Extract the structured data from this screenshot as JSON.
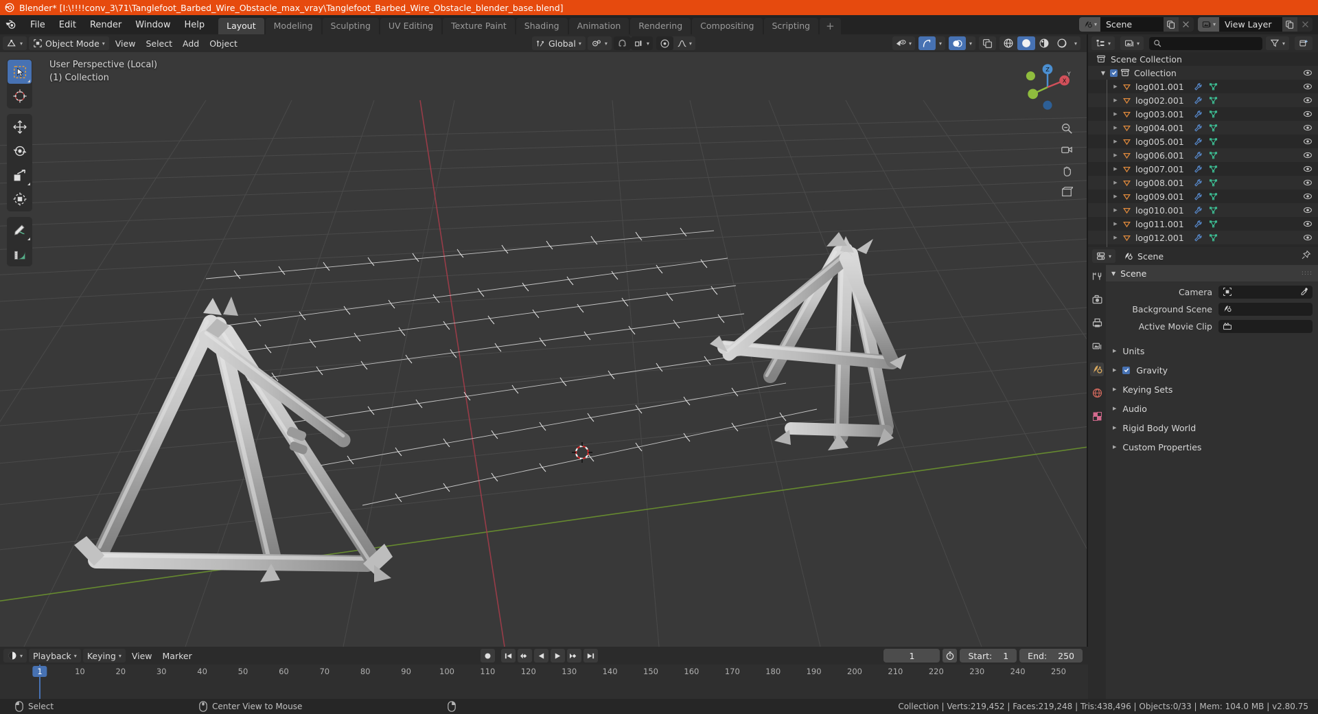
{
  "window": {
    "title": "Blender* [I:\\!!!!conv_3\\71\\Tanglefoot_Barbed_Wire_Obstacle_max_vray\\Tanglefoot_Barbed_Wire_Obstacle_blender_base.blend]",
    "app_icon": "blender-logo-icon"
  },
  "topbar": {
    "menus": [
      "File",
      "Edit",
      "Render",
      "Window",
      "Help"
    ],
    "workspace_tabs": [
      {
        "label": "Layout",
        "active": true
      },
      {
        "label": "Modeling",
        "active": false
      },
      {
        "label": "Sculpting",
        "active": false
      },
      {
        "label": "UV Editing",
        "active": false
      },
      {
        "label": "Texture Paint",
        "active": false
      },
      {
        "label": "Shading",
        "active": false
      },
      {
        "label": "Animation",
        "active": false
      },
      {
        "label": "Rendering",
        "active": false
      },
      {
        "label": "Compositing",
        "active": false
      },
      {
        "label": "Scripting",
        "active": false
      }
    ],
    "add_workspace_label": "+",
    "scene": {
      "name": "Scene",
      "icon": "scene-icon",
      "new_icon": "duplicate-icon",
      "unlink_icon": "close-icon"
    },
    "view_layer": {
      "name": "View Layer",
      "icon": "view-layer-icon",
      "new_icon": "duplicate-icon",
      "unlink_icon": "close-icon"
    }
  },
  "viewport_header": {
    "editor_type_icon": "editor-type-3dview-icon",
    "mode": "Object Mode",
    "mode_icon": "object-mode-icon",
    "menus": [
      "View",
      "Select",
      "Add",
      "Object"
    ],
    "transform_orientation": "Global",
    "transform_orientation_icon": "orientation-icon",
    "pivot_icon": "pivot-point-icon",
    "snap_icon": "magnet-icon",
    "snap_target_icon": "snap-increment-icon",
    "proportional_icon": "proportional-edit-icon",
    "falloff_icon": "smooth-falloff-icon",
    "visibility_icon": "visibility-icon",
    "gizmo_icon": "gizmo-icon",
    "overlays_icon": "overlays-icon",
    "xray_icon": "xray-icon",
    "shading_modes": [
      {
        "name": "wireframe-shading",
        "active": false
      },
      {
        "name": "solid-shading",
        "active": true
      },
      {
        "name": "material-preview-shading",
        "active": false
      },
      {
        "name": "rendered-shading",
        "active": false
      }
    ]
  },
  "viewport": {
    "overlay_line1": "User Perspective (Local)",
    "overlay_line2": "(1) Collection",
    "background_color": "#393939",
    "grid_color": "#4b4b4b",
    "x_axis_color": "#a33d4a",
    "y_axis_color": "#6b932f",
    "tools": [
      {
        "name": "tweak-select-box-tool",
        "label": "Select Box",
        "active": true
      },
      {
        "name": "cursor-tool",
        "label": "Cursor",
        "active": false
      },
      {
        "name": "move-tool",
        "label": "Move",
        "active": false
      },
      {
        "name": "rotate-tool",
        "label": "Rotate",
        "active": false
      },
      {
        "name": "scale-tool",
        "label": "Scale",
        "active": false
      },
      {
        "name": "transform-tool",
        "label": "Transform",
        "active": false
      },
      {
        "name": "annotate-tool",
        "label": "Annotate",
        "active": false
      },
      {
        "name": "measure-tool",
        "label": "Measure",
        "active": false
      }
    ],
    "gizmo_axes": [
      {
        "label": "X",
        "color": "#d1505a"
      },
      {
        "label": "Y",
        "color": "#8fbc3e"
      },
      {
        "label": "Z",
        "color": "#4b8fd1"
      }
    ],
    "nav_buttons": [
      "zoom-icon",
      "camera-icon",
      "hand-icon",
      "perspective-icon"
    ]
  },
  "outliner": {
    "display_mode_icon": "outliner-display-mode-icon",
    "filter_id_icon": "filter-id-icon",
    "search_placeholder": "",
    "search_value": "",
    "filter_icon": "funnel-icon",
    "new_collection_icon": "new-collection-icon",
    "scene_collection": {
      "label": "Scene Collection",
      "icon": "collection-icon"
    },
    "collection": {
      "label": "Collection",
      "icon": "collection-icon",
      "checked": true,
      "expanded": true
    },
    "objects": [
      {
        "name": "log001.001"
      },
      {
        "name": "log002.001"
      },
      {
        "name": "log003.001"
      },
      {
        "name": "log004.001"
      },
      {
        "name": "log005.001"
      },
      {
        "name": "log006.001"
      },
      {
        "name": "log007.001"
      },
      {
        "name": "log008.001"
      },
      {
        "name": "log009.001"
      },
      {
        "name": "log010.001"
      },
      {
        "name": "log011.001"
      },
      {
        "name": "log012.001"
      }
    ],
    "object_icon": "mesh-object-icon",
    "modifier_icon": "wrench-modifier-icon",
    "mesh_data_icon": "mesh-data-icon",
    "visibility_icon": "eye-icon",
    "colors": {
      "object": "#e08a3c",
      "modifier": "#5a8fd6",
      "mesh_data": "#3ec79a"
    }
  },
  "properties": {
    "editor_icon": "properties-editor-icon",
    "breadcrumb": "Scene",
    "breadcrumb_icon": "scene-icon",
    "pin_icon": "pin-icon",
    "tabs": [
      {
        "name": "tool-tab",
        "icon": "tool-icon",
        "active": false
      },
      {
        "name": "render-tab",
        "icon": "camera-back-icon",
        "active": false
      },
      {
        "name": "output-tab",
        "icon": "printer-icon",
        "active": false
      },
      {
        "name": "view-layer-tab",
        "icon": "images-icon",
        "active": false
      },
      {
        "name": "scene-tab",
        "icon": "scene-icon",
        "active": true
      },
      {
        "name": "world-tab",
        "icon": "world-icon",
        "active": false
      },
      {
        "name": "texture-tab",
        "icon": "checker-icon",
        "active": false
      }
    ],
    "panel_title": "Scene",
    "fields": [
      {
        "label": "Camera",
        "value": "",
        "icon": "camera-object-icon",
        "has_eyedropper": true
      },
      {
        "label": "Background Scene",
        "value": "",
        "icon": "scene-icon",
        "has_eyedropper": false
      },
      {
        "label": "Active Movie Clip",
        "value": "",
        "icon": "movie-clip-icon",
        "has_eyedropper": false
      }
    ],
    "sections": [
      {
        "label": "Units",
        "has_checkbox": false,
        "checked": false
      },
      {
        "label": "Gravity",
        "has_checkbox": true,
        "checked": true
      },
      {
        "label": "Keying Sets",
        "has_checkbox": false,
        "checked": false
      },
      {
        "label": "Audio",
        "has_checkbox": false,
        "checked": false
      },
      {
        "label": "Rigid Body World",
        "has_checkbox": false,
        "checked": false
      },
      {
        "label": "Custom Properties",
        "has_checkbox": false,
        "checked": false
      }
    ]
  },
  "timeline": {
    "editor_icon": "timeline-editor-icon",
    "menus": [
      "Playback",
      "Keying",
      "View",
      "Marker"
    ],
    "transport": [
      {
        "name": "record-button",
        "icon": "record-icon"
      },
      {
        "name": "jump-start-button",
        "icon": "jump-to-start-icon"
      },
      {
        "name": "prev-keyframe-button",
        "icon": "prev-keyframe-icon"
      },
      {
        "name": "play-reverse-button",
        "icon": "play-reverse-icon"
      },
      {
        "name": "play-button",
        "icon": "play-icon"
      },
      {
        "name": "next-keyframe-button",
        "icon": "next-keyframe-icon"
      },
      {
        "name": "jump-end-button",
        "icon": "jump-to-end-icon"
      }
    ],
    "current_frame": "1",
    "autokey_icon": "stopwatch-icon",
    "start_label": "Start:",
    "start_value": "1",
    "end_label": "End:",
    "end_value": "250",
    "ruler_ticks": [
      "10",
      "20",
      "30",
      "40",
      "50",
      "60",
      "70",
      "80",
      "90",
      "100",
      "110",
      "120",
      "130",
      "140",
      "150",
      "160",
      "170",
      "180",
      "190",
      "200",
      "210",
      "220",
      "230",
      "240",
      "250"
    ],
    "playhead_frame": "1"
  },
  "statusbar": {
    "left_items": [
      {
        "icon": "mouse-left-icon",
        "label": "Select"
      },
      {
        "icon": "mouse-middle-icon",
        "label": "Center View to Mouse"
      },
      {
        "icon": "mouse-right-icon",
        "label": ""
      }
    ],
    "stats": "Collection | Verts:219,452 | Faces:219,248 | Tris:438,496 | Objects:0/33 | Mem: 104.0 MB | v2.80.75"
  }
}
